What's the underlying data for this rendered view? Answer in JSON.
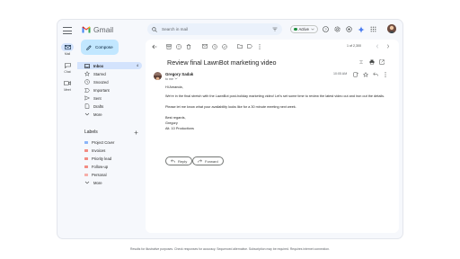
{
  "app": {
    "name": "Gmail"
  },
  "rail": {
    "items": [
      {
        "label": "Mail",
        "icon": "mail-icon"
      },
      {
        "label": "Chat",
        "icon": "chat-icon"
      },
      {
        "label": "Meet",
        "icon": "video-icon"
      }
    ]
  },
  "search": {
    "placeholder": "Search in mail"
  },
  "status": {
    "label": "Active"
  },
  "compose": {
    "label": "Compose"
  },
  "sidebar": {
    "items": [
      {
        "label": "Inbox",
        "count": "4",
        "icon": "inbox-icon"
      },
      {
        "label": "Starred",
        "count": "",
        "icon": "star-icon"
      },
      {
        "label": "Snoozed",
        "count": "",
        "icon": "clock-icon"
      },
      {
        "label": "Important",
        "count": "",
        "icon": "important-icon"
      },
      {
        "label": "Sent",
        "count": "",
        "icon": "send-icon"
      },
      {
        "label": "Drafts",
        "count": "",
        "icon": "draft-icon"
      },
      {
        "label": "More",
        "count": "",
        "icon": "chevron-down-icon"
      }
    ],
    "labels_title": "Labels",
    "labels": [
      {
        "label": "Project Cover",
        "color": "#8ab4f8"
      },
      {
        "label": "Invoices",
        "color": "#f28b82"
      },
      {
        "label": "Priority lead",
        "color": "#f28b82"
      },
      {
        "label": "Follow-up",
        "color": "#f28b82"
      },
      {
        "label": "Personal",
        "color": "#f6aea9"
      },
      {
        "label": "More",
        "color": ""
      }
    ]
  },
  "pager": {
    "text": "1 of 2,300"
  },
  "email": {
    "subject": "Review final LawnBot marketing video",
    "sender": "Gregory Sadak",
    "to": "to me",
    "time": "10:05 AM",
    "body": [
      "Hi Amanda,",
      "We're in the final stretch with the LawnBot post-holiday marketing video! Let's set some time to review the latest video cut and iron out the details.",
      "Please let me know what your availability looks like for a 30 minute meeting next week.",
      "Best regards,",
      "Gregory",
      "Alt. 10 Productions"
    ],
    "reply_label": "Reply",
    "forward_label": "Forward"
  },
  "footer": {
    "disclaimer": "Results for illustrative purposes. Check responses for accuracy. Sequenced alternative. Subscription may be required. Requires internet connection."
  },
  "colors": {
    "accent": "#0b57d0",
    "compose_bg": "#c2e7ff",
    "selected_bg": "#d3e3fd",
    "frame_bg": "#f6f8fc"
  }
}
